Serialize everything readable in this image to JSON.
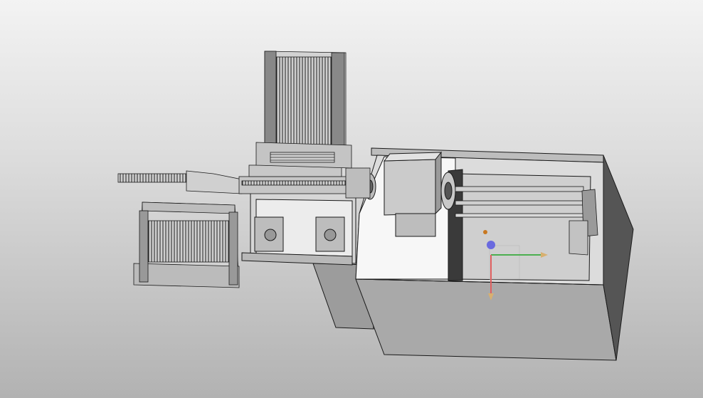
{
  "viewport": {
    "background_top": "#f3f3f3",
    "background_bottom": "#b2b2b2"
  },
  "model": {
    "part_color": "#d4d4d4",
    "edge_color": "#1a1a1a",
    "shadow_color": "#6a6a6a",
    "dark_face": "#4a4a4a",
    "interior_color": "#f6f6f6"
  },
  "triad": {
    "x_color": "#4caf50",
    "y_color": "#e06060",
    "z_color": "#6a6adf",
    "arrow_color": "#d8b070"
  }
}
